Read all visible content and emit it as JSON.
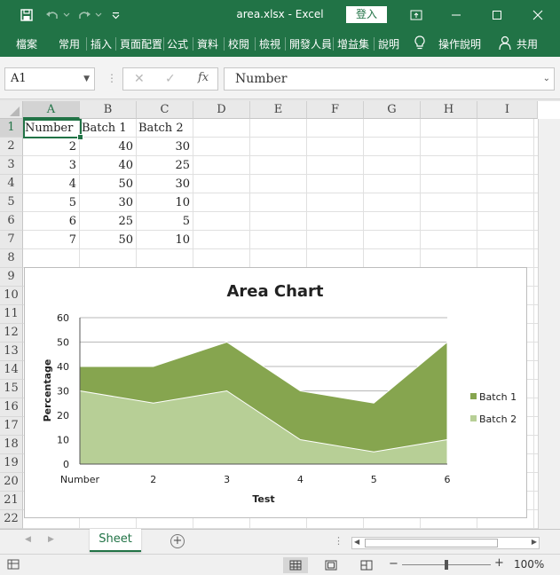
{
  "app": {
    "filename": "area.xlsx",
    "separator": "-",
    "appname": "Excel",
    "login": "登入"
  },
  "ribbon": {
    "tabs": [
      "檔案",
      "常用",
      "插入",
      "頁面配置",
      "公式",
      "資料",
      "校閱",
      "檢視",
      "開發人員",
      "增益集",
      "說明"
    ],
    "tell_me": "操作說明",
    "share": "共用"
  },
  "formula_bar": {
    "name_box": "A1",
    "content": "Number"
  },
  "columns": [
    "A",
    "B",
    "C",
    "D",
    "E",
    "F",
    "G",
    "H",
    "I"
  ],
  "rows": [
    "1",
    "2",
    "3",
    "4",
    "5",
    "6",
    "7",
    "8",
    "9",
    "10",
    "11",
    "12",
    "13",
    "14",
    "15",
    "16",
    "17",
    "18",
    "19",
    "20",
    "21",
    "22"
  ],
  "sheet": {
    "header": [
      "Number",
      "Batch 1",
      "Batch 2"
    ],
    "data": [
      [
        "2",
        "40",
        "30"
      ],
      [
        "3",
        "40",
        "25"
      ],
      [
        "4",
        "50",
        "30"
      ],
      [
        "5",
        "30",
        "10"
      ],
      [
        "6",
        "25",
        "5"
      ],
      [
        "7",
        "50",
        "10"
      ]
    ]
  },
  "chart_data": {
    "type": "area",
    "title": "Area Chart",
    "xlabel": "Test",
    "ylabel": "Percentage",
    "categories": [
      "Number",
      "2",
      "3",
      "4",
      "5",
      "6"
    ],
    "series": [
      {
        "name": "Batch 1",
        "values": [
          40,
          40,
          50,
          30,
          25,
          50
        ],
        "color": "#86a54f"
      },
      {
        "name": "Batch 2",
        "values": [
          30,
          25,
          30,
          10,
          5,
          10
        ],
        "color": "#b7cf96"
      }
    ],
    "yticks": [
      "0",
      "10",
      "20",
      "30",
      "40",
      "50",
      "60"
    ],
    "ylim": [
      0,
      60
    ],
    "grid": true,
    "legend": "right"
  },
  "tabs": {
    "sheet_name": "Sheet"
  },
  "status": {
    "zoom": "100%"
  },
  "colors": {
    "accent": "#217346"
  }
}
